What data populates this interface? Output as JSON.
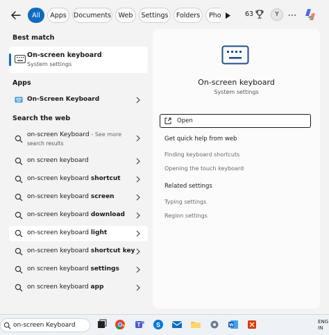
{
  "filters": {
    "tabs": [
      {
        "label": "All",
        "active": true
      },
      {
        "label": "Apps"
      },
      {
        "label": "Documents"
      },
      {
        "label": "Web"
      },
      {
        "label": "Settings"
      },
      {
        "label": "Folders"
      },
      {
        "label": "Pho"
      }
    ],
    "points": "63",
    "avatar_initial": "Y",
    "more_label": "⋯"
  },
  "best_match": {
    "heading": "Best match",
    "title": "On-screen keyboard",
    "subtitle": "System settings"
  },
  "apps": {
    "heading": "Apps",
    "items": [
      {
        "label": "On-Screen Keyboard"
      }
    ]
  },
  "web": {
    "heading": "Search the web",
    "first": {
      "label": "on-screen Keyboard",
      "see_more": "- See more",
      "sub": "search results"
    },
    "items": [
      {
        "prefix": "on screen keyboard",
        "bold": ""
      },
      {
        "prefix": "on-screen keyboard ",
        "bold": "shortcut"
      },
      {
        "prefix": "on-screen keyboard ",
        "bold": "screen"
      },
      {
        "prefix": "on-screen keyboard ",
        "bold": "download"
      },
      {
        "prefix": "on-screen keyboard ",
        "bold": "light"
      },
      {
        "prefix": "on-screen keyboard ",
        "bold": "shortcut key"
      },
      {
        "prefix": "on screen keyboard ",
        "bold": "settings"
      },
      {
        "prefix": "on screen keyboard ",
        "bold": "app"
      }
    ]
  },
  "preview": {
    "title": "On-screen keyboard",
    "subtitle": "System settings",
    "open_label": "Open",
    "help_heading": "Get quick help from web",
    "help_links": [
      "Finding keyboard shortcuts",
      "Opening the touch keyboard"
    ],
    "related_heading": "Related settings",
    "related_links": [
      "Typing settings",
      "Region settings"
    ]
  },
  "taskbar": {
    "search_text": "on-screen Keyboard",
    "lang_line1": "ENG",
    "lang_line2": "IN"
  },
  "colors": {
    "accent": "#0f6cbd",
    "panel_bg": "#f3f3f3",
    "pane_bg": "#fbfbfb"
  }
}
